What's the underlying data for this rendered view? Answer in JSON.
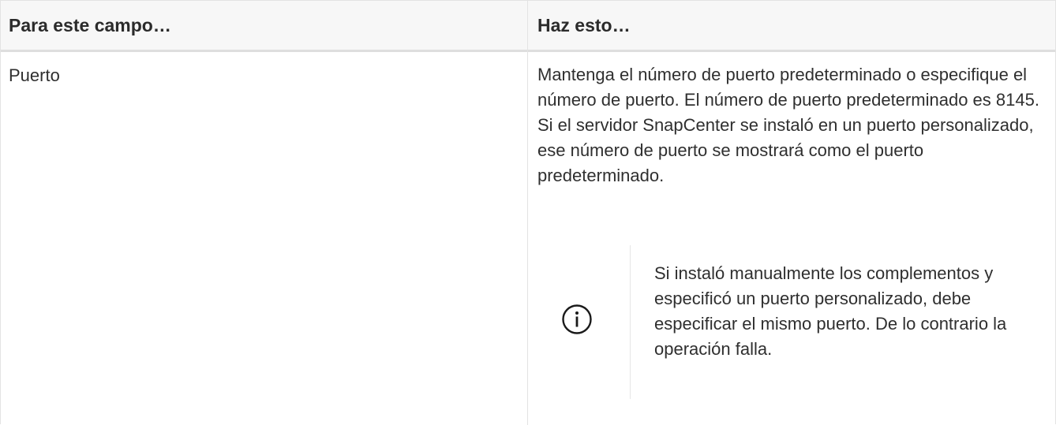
{
  "table": {
    "headers": {
      "field": "Para este campo…",
      "action": "Haz esto…"
    },
    "rows": [
      {
        "field": "Puerto",
        "action": "Mantenga el número de puerto predeterminado o especifique el número de puerto. El número de puerto predeterminado es 8145. Si el servidor SnapCenter se instaló en un puerto personalizado, ese número de puerto se mostrará como el puerto predeterminado.",
        "note": {
          "icon": "info-circle-icon",
          "text": "Si instaló manualmente los complementos y especificó un puerto personalizado, debe especificar el mismo puerto. De lo contrario la operación falla."
        }
      }
    ]
  },
  "colors": {
    "text": "#2f2f2f",
    "header_bg": "#f7f7f7",
    "border": "#e3e3e3",
    "icon": "#1a1a1a"
  }
}
